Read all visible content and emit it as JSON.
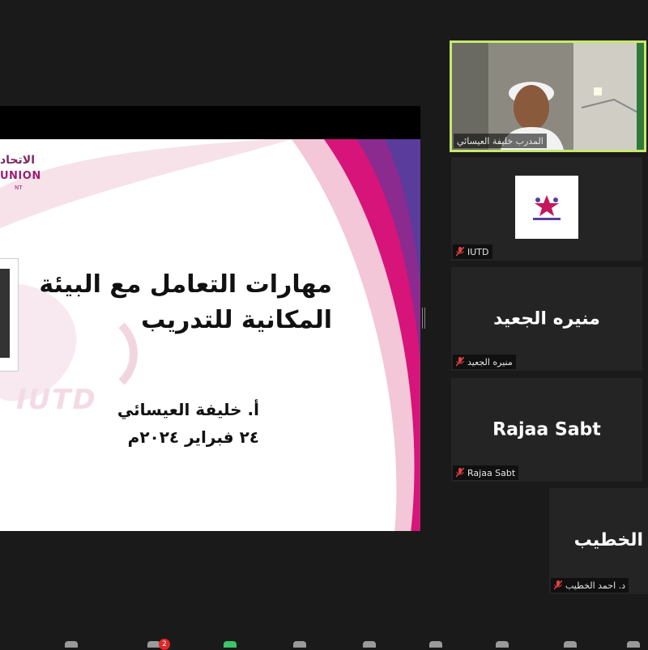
{
  "slide": {
    "logo_arabic": "الاتحاد",
    "logo_english": "UNION",
    "logo_sub": "NT",
    "watermark": "IUTD",
    "title_line1": "مهارات التعامل مع البيئة",
    "title_line2": "المكانية للتدريب",
    "author": "أ. خليفة العيسائي",
    "date": "٢٤ فبراير ٢٠٢٤م"
  },
  "participants": {
    "speaker": {
      "name": "المدرب خليفة العيسائي"
    },
    "iutd": {
      "name": "IUTD"
    },
    "munira": {
      "display": "منيره الجعيد",
      "name": "منيره الجعيد"
    },
    "rajaa": {
      "display": "Rajaa Sabt",
      "name": "Rajaa Sabt"
    },
    "ahmad": {
      "display": "الخطيب",
      "name": "د. احمد الخطيب"
    }
  },
  "toolbar": {
    "chat_badge": "2"
  },
  "colors": {
    "active_speaker_border": "#c7e86b",
    "muted_icon": "#e04040",
    "slide_accent": "#c2185b"
  }
}
